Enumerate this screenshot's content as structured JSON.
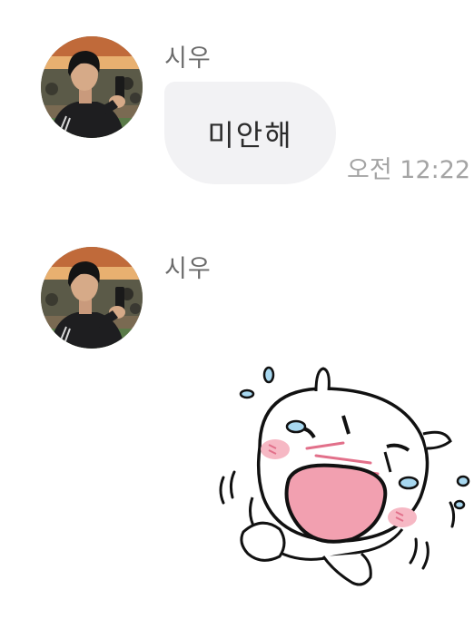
{
  "messages": [
    {
      "sender": "시우",
      "text": "미안해",
      "time": "오전 12:22"
    },
    {
      "sender": "시우",
      "sticker": "crying-white-character-sticker"
    }
  ],
  "icons": {
    "avatar": "profile-photo-person-holding-phone"
  },
  "colors": {
    "bubble": "#f2f2f4",
    "sender_text": "#6b6b6b",
    "time_text": "#a4a4a4",
    "message_text": "#2c2c2c",
    "sticker_mouth": "#f2a0b0",
    "sticker_tears": "#a8d8f0"
  }
}
